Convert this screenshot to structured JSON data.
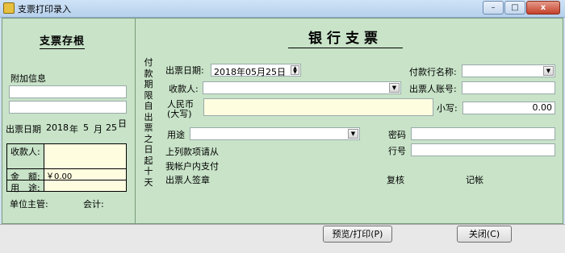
{
  "window": {
    "title": "支票打印录入",
    "min": "–",
    "max": "□",
    "close": "x"
  },
  "stub": {
    "title": "支票存根",
    "extra_label": "附加信息",
    "date_label": "出票日期",
    "year": "2018",
    "year_unit": "年",
    "month": "5",
    "month_unit": "月",
    "day": "25",
    "day_unit": "日",
    "payee_label": "收款人:",
    "amount_label": "金　额:",
    "amount_value": "￥0.00",
    "use_label": "用　途:",
    "supervisor_label": "单位主管:",
    "accountant_label": "会计:"
  },
  "cheque": {
    "title": "银行支票",
    "vertical_note": "付款期限自出票之日起十天",
    "date_label": "出票日期:",
    "date_value": "2018年05月25日",
    "payer_bank_label": "付款行名称:",
    "payee_label": "收款人:",
    "drawer_account_label": "出票人账号:",
    "rmb_label_1": "人民币",
    "rmb_label_2": "(大写)",
    "small_label": "小写:",
    "small_value": "0.00",
    "use_label": "用途",
    "password_label": "密码",
    "bank_no_label": "行号",
    "text1": "上列款项请从",
    "text2": "我帐户内支付",
    "drawer_sign": "出票人签章",
    "recheck": "复核",
    "bookkeep": "记帐"
  },
  "buttons": {
    "preview": "预览/打印(P)",
    "close": "关闭(C)"
  }
}
